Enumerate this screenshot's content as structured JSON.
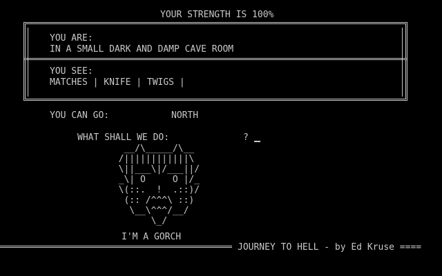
{
  "status": {
    "strength_label": "YOUR STRENGTH IS 100%"
  },
  "location": {
    "heading": "YOU ARE:",
    "description": "IN A SMALL DARK AND DAMP CAVE ROOM"
  },
  "inventory": {
    "heading": "YOU SEE:",
    "items_line": "MATCHES | KNIFE | TWIGS |"
  },
  "exits": {
    "label": "YOU CAN GO:",
    "directions": "NORTH"
  },
  "prompt": {
    "question": "WHAT SHALL WE DO:",
    "marker": "?"
  },
  "character": {
    "art": "   __/\\_____/\\__\n  /||||||||||||\\\n  \\||___\\|/___||/\n  _\\| O     O |/_\n  \\(::.  !  .::)/\n   (:: /^^^\\ ::)\n    \\__\\^^^/__/\n        \\_/",
    "caption": "I'M A GORCH"
  },
  "footer": {
    "title": "JOURNEY TO HELL - by Ed Kruse ===="
  },
  "colors": {
    "background": "#000000",
    "text": "#c8c8c8"
  }
}
